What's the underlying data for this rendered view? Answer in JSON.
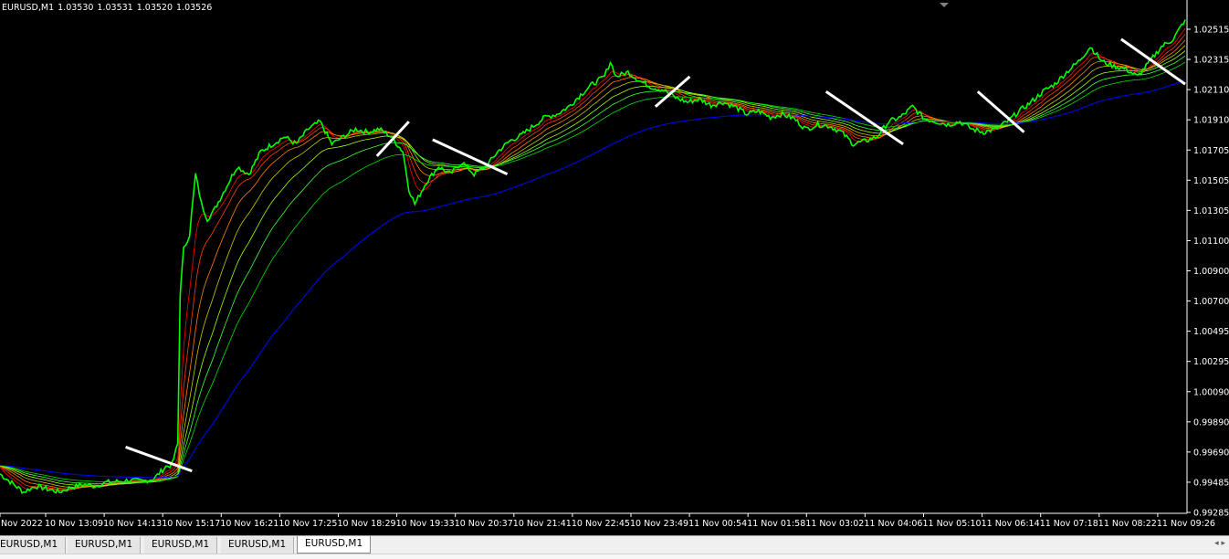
{
  "window": {
    "header": {
      "symbol": "EURUSD,M1",
      "open": "1.03530",
      "high": "1.03531",
      "low": "1.03520",
      "close": "1.03526"
    }
  },
  "chart_data": {
    "type": "line",
    "price_axis": {
      "ticks": [
        "1.02515",
        "1.02315",
        "1.02110",
        "1.01910",
        "1.01705",
        "1.01505",
        "1.01305",
        "1.01100",
        "1.00900",
        "1.00700",
        "1.00495",
        "1.00295",
        "1.00090",
        "0.99890",
        "0.99690",
        "0.99485",
        "0.99285"
      ],
      "ylim": [
        0.9925,
        1.026
      ]
    },
    "time_axis": {
      "ticks": [
        "Nov 2022",
        "10 Nov 13:09",
        "10 Nov 14:13",
        "10 Nov 15:17",
        "10 Nov 16:21",
        "10 Nov 17:25",
        "10 Nov 18:29",
        "10 Nov 19:33",
        "10 Nov 20:37",
        "10 Nov 21:41",
        "10 Nov 22:45",
        "10 Nov 23:49",
        "11 Nov 00:54",
        "11 Nov 01:58",
        "11 Nov 03:02",
        "11 Nov 04:06",
        "11 Nov 05:10",
        "11 Nov 06:14",
        "11 Nov 07:18",
        "11 Nov 08:22",
        "11 Nov 09:26"
      ]
    },
    "price_series_color": "#00ff00",
    "ma_ribbon_colors": [
      "#ff0000",
      "#ff4000",
      "#ff8000",
      "#c8c800",
      "#a0ff00",
      "#40ff40",
      "#00e000"
    ],
    "slow_ma_color": "#0000ff",
    "annotation_color": "#ffffff",
    "price_path": [
      [
        0,
        0.995
      ],
      [
        0.01,
        0.9944
      ],
      [
        0.02,
        0.9938
      ],
      [
        0.03,
        0.9942
      ],
      [
        0.04,
        0.994
      ],
      [
        0.05,
        0.9938
      ],
      [
        0.06,
        0.9941
      ],
      [
        0.07,
        0.9943
      ],
      [
        0.08,
        0.9942
      ],
      [
        0.09,
        0.99445
      ],
      [
        0.1,
        0.9945
      ],
      [
        0.11,
        0.9946
      ],
      [
        0.12,
        0.9945
      ],
      [
        0.13,
        0.9947
      ],
      [
        0.14,
        0.9955
      ],
      [
        0.145,
        0.9956
      ],
      [
        0.15,
        0.997
      ],
      [
        0.152,
        1.007
      ],
      [
        0.155,
        1.01
      ],
      [
        0.16,
        1.011
      ],
      [
        0.165,
        1.015
      ],
      [
        0.17,
        1.013
      ],
      [
        0.175,
        1.012
      ],
      [
        0.18,
        1.0125
      ],
      [
        0.19,
        1.014
      ],
      [
        0.2,
        1.0155
      ],
      [
        0.21,
        1.015
      ],
      [
        0.22,
        1.0165
      ],
      [
        0.23,
        1.017
      ],
      [
        0.24,
        1.0175
      ],
      [
        0.25,
        1.017
      ],
      [
        0.26,
        1.018
      ],
      [
        0.27,
        1.0185
      ],
      [
        0.28,
        1.017
      ],
      [
        0.29,
        1.0175
      ],
      [
        0.3,
        1.018
      ],
      [
        0.31,
        1.0178
      ],
      [
        0.32,
        1.018
      ],
      [
        0.33,
        1.0175
      ],
      [
        0.34,
        1.0165
      ],
      [
        0.345,
        1.014
      ],
      [
        0.35,
        1.013
      ],
      [
        0.36,
        1.0145
      ],
      [
        0.37,
        1.0155
      ],
      [
        0.38,
        1.015
      ],
      [
        0.39,
        1.0158
      ],
      [
        0.4,
        1.015
      ],
      [
        0.41,
        1.0155
      ],
      [
        0.42,
        1.0165
      ],
      [
        0.43,
        1.0172
      ],
      [
        0.44,
        1.0176
      ],
      [
        0.45,
        1.0182
      ],
      [
        0.46,
        1.0188
      ],
      [
        0.47,
        1.019
      ],
      [
        0.48,
        1.0195
      ],
      [
        0.49,
        1.0203
      ],
      [
        0.5,
        1.021
      ],
      [
        0.51,
        1.0215
      ],
      [
        0.515,
        1.0225
      ],
      [
        0.52,
        1.0215
      ],
      [
        0.53,
        1.0218
      ],
      [
        0.54,
        1.0212
      ],
      [
        0.55,
        1.0208
      ],
      [
        0.56,
        1.0206
      ],
      [
        0.57,
        1.0201
      ],
      [
        0.58,
        1.0198
      ],
      [
        0.59,
        1.02
      ],
      [
        0.6,
        1.0196
      ],
      [
        0.61,
        1.0198
      ],
      [
        0.62,
        1.0195
      ],
      [
        0.63,
        1.019
      ],
      [
        0.64,
        1.0192
      ],
      [
        0.65,
        1.0188
      ],
      [
        0.66,
        1.019
      ],
      [
        0.67,
        1.0187
      ],
      [
        0.68,
        1.018
      ],
      [
        0.69,
        1.0183
      ],
      [
        0.7,
        1.0182
      ],
      [
        0.71,
        1.0178
      ],
      [
        0.72,
        1.017
      ],
      [
        0.73,
        1.0172
      ],
      [
        0.74,
        1.0175
      ],
      [
        0.75,
        1.0185
      ],
      [
        0.76,
        1.0188
      ],
      [
        0.77,
        1.0195
      ],
      [
        0.78,
        1.0187
      ],
      [
        0.79,
        1.0185
      ],
      [
        0.8,
        1.0183
      ],
      [
        0.81,
        1.0185
      ],
      [
        0.82,
        1.018
      ],
      [
        0.83,
        1.0178
      ],
      [
        0.84,
        1.018
      ],
      [
        0.85,
        1.0185
      ],
      [
        0.86,
        1.0192
      ],
      [
        0.87,
        1.0198
      ],
      [
        0.88,
        1.0205
      ],
      [
        0.89,
        1.021
      ],
      [
        0.9,
        1.0218
      ],
      [
        0.91,
        1.0225
      ],
      [
        0.92,
        1.0235
      ],
      [
        0.93,
        1.0225
      ],
      [
        0.94,
        1.0222
      ],
      [
        0.95,
        1.022
      ],
      [
        0.96,
        1.0215
      ],
      [
        0.97,
        1.0225
      ],
      [
        0.98,
        1.0235
      ],
      [
        0.99,
        1.024
      ],
      [
        1.0,
        1.0253
      ]
    ],
    "annotations": [
      {
        "from": [
          0.106,
          0.9968
        ],
        "to": [
          0.162,
          0.9952
        ]
      },
      {
        "from": [
          0.318,
          1.0162
        ],
        "to": [
          0.345,
          1.0185
        ]
      },
      {
        "from": [
          0.365,
          1.0173
        ],
        "to": [
          0.428,
          1.015
        ]
      },
      {
        "from": [
          0.553,
          1.0195
        ],
        "to": [
          0.582,
          1.0215
        ]
      },
      {
        "from": [
          0.697,
          1.0205
        ],
        "to": [
          0.762,
          1.017
        ]
      },
      {
        "from": [
          0.825,
          1.0205
        ],
        "to": [
          0.864,
          1.0178
        ]
      },
      {
        "from": [
          0.946,
          1.024
        ],
        "to": [
          1.0,
          1.021
        ]
      }
    ]
  },
  "tabs": [
    {
      "label": "EURUSD,M1"
    },
    {
      "label": "EURUSD,M1"
    },
    {
      "label": "EURUSD,M1"
    },
    {
      "label": "EURUSD,M1"
    },
    {
      "label": "EURUSD,M1"
    }
  ]
}
